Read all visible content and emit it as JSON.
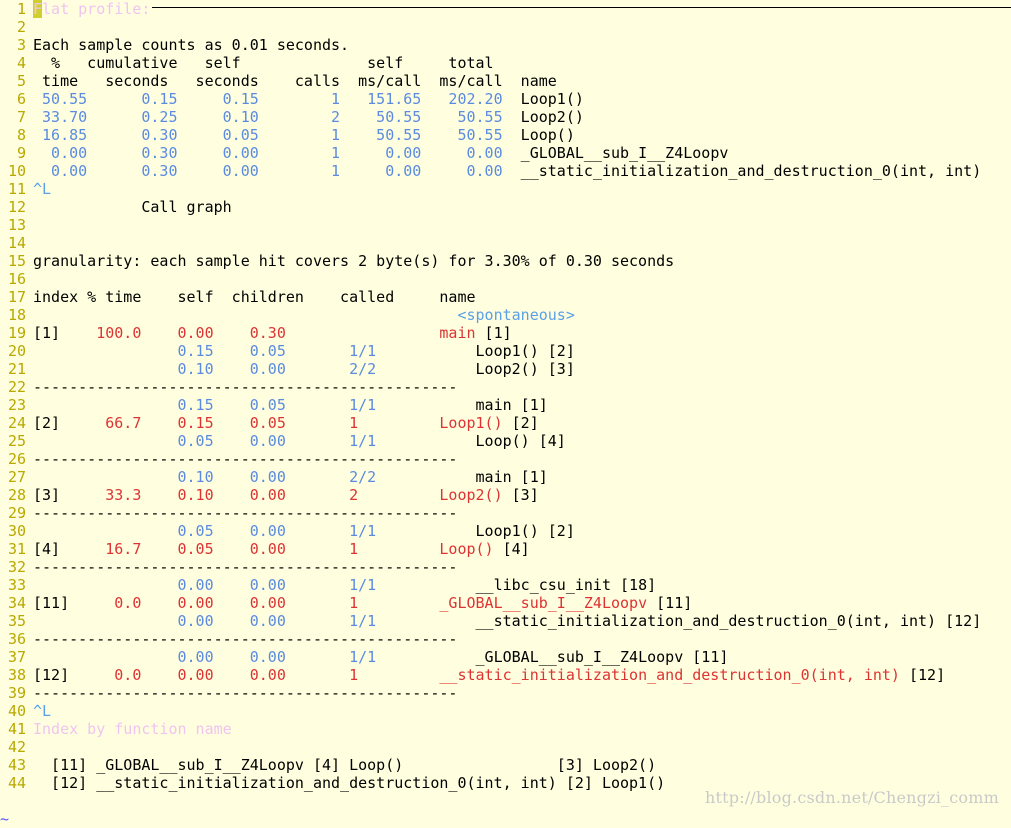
{
  "colors": {
    "default": "#000000",
    "number": "#5a8be0",
    "highlight": "#dd3333",
    "control": "#5aa0e8",
    "comment": "#f0c4f0",
    "linenumber": "#b8a800"
  },
  "lines": [
    {
      "num": "1",
      "segments": [
        {
          "t": "F",
          "c": "comment",
          "cursor": true
        },
        {
          "t": "lat profile:",
          "c": "comment"
        }
      ],
      "rule": true
    },
    {
      "num": "2",
      "segments": []
    },
    {
      "num": "3",
      "segments": [
        {
          "t": "Each sample counts as 0.01 seconds.",
          "c": "default"
        }
      ]
    },
    {
      "num": "4",
      "segments": [
        {
          "t": "  %   cumulative   self              self     total",
          "c": "default"
        }
      ]
    },
    {
      "num": "5",
      "segments": [
        {
          "t": " time   seconds   seconds    calls  ms/call  ms/call  name",
          "c": "default"
        }
      ]
    },
    {
      "num": "6",
      "segments": [
        {
          "t": " 50.55      0.15     0.15        1   151.65   202.20  ",
          "c": "number"
        },
        {
          "t": "Loop1()",
          "c": "default"
        }
      ]
    },
    {
      "num": "7",
      "segments": [
        {
          "t": " 33.70      0.25     0.10        2    50.55    50.55  ",
          "c": "number"
        },
        {
          "t": "Loop2()",
          "c": "default"
        }
      ]
    },
    {
      "num": "8",
      "segments": [
        {
          "t": " 16.85      0.30     0.05        1    50.55    50.55  ",
          "c": "number"
        },
        {
          "t": "Loop()",
          "c": "default"
        }
      ]
    },
    {
      "num": "9",
      "segments": [
        {
          "t": "  0.00      0.30     0.00        1     0.00     0.00  ",
          "c": "number"
        },
        {
          "t": "_GLOBAL__sub_I__Z4Loopv",
          "c": "default"
        }
      ]
    },
    {
      "num": "10",
      "segments": [
        {
          "t": "  0.00      0.30     0.00        1     0.00     0.00  ",
          "c": "number"
        },
        {
          "t": "__static_initialization_and_destruction_0(int, int)",
          "c": "default"
        }
      ]
    },
    {
      "num": "11",
      "segments": [
        {
          "t": "^L",
          "c": "control"
        }
      ]
    },
    {
      "num": "12",
      "segments": [
        {
          "t": "            Call graph",
          "c": "default"
        }
      ]
    },
    {
      "num": "13",
      "segments": []
    },
    {
      "num": "14",
      "segments": []
    },
    {
      "num": "15",
      "segments": [
        {
          "t": "granularity: each sample hit covers 2 byte(s) for 3.30% of 0.30 seconds",
          "c": "default"
        }
      ]
    },
    {
      "num": "16",
      "segments": []
    },
    {
      "num": "17",
      "segments": [
        {
          "t": "index % time    self  children    called     name",
          "c": "default"
        }
      ]
    },
    {
      "num": "18",
      "segments": [
        {
          "t": "                                               <spontaneous>",
          "c": "control"
        }
      ]
    },
    {
      "num": "19",
      "segments": [
        {
          "t": "[1]    ",
          "c": "default"
        },
        {
          "t": "100.0    0.00    0.30                 main",
          "c": "highlight"
        },
        {
          "t": " [1]",
          "c": "default"
        }
      ]
    },
    {
      "num": "20",
      "segments": [
        {
          "t": "                0.15    0.05       1/1           ",
          "c": "number"
        },
        {
          "t": "Loop1() [2]",
          "c": "default"
        }
      ]
    },
    {
      "num": "21",
      "segments": [
        {
          "t": "                0.10    0.00       2/2           ",
          "c": "number"
        },
        {
          "t": "Loop2() [3]",
          "c": "default"
        }
      ]
    },
    {
      "num": "22",
      "segments": [
        {
          "t": "-----------------------------------------------",
          "c": "default"
        }
      ]
    },
    {
      "num": "23",
      "segments": [
        {
          "t": "                0.15    0.05       1/1           ",
          "c": "number"
        },
        {
          "t": "main [1]",
          "c": "default"
        }
      ]
    },
    {
      "num": "24",
      "segments": [
        {
          "t": "[2]     ",
          "c": "default"
        },
        {
          "t": "66.7    0.15    0.05       1         Loop1()",
          "c": "highlight"
        },
        {
          "t": " [2]",
          "c": "default"
        }
      ]
    },
    {
      "num": "25",
      "segments": [
        {
          "t": "                0.05    0.00       1/1           ",
          "c": "number"
        },
        {
          "t": "Loop() [4]",
          "c": "default"
        }
      ]
    },
    {
      "num": "26",
      "segments": [
        {
          "t": "-----------------------------------------------",
          "c": "default"
        }
      ]
    },
    {
      "num": "27",
      "segments": [
        {
          "t": "                0.10    0.00       2/2           ",
          "c": "number"
        },
        {
          "t": "main [1]",
          "c": "default"
        }
      ]
    },
    {
      "num": "28",
      "segments": [
        {
          "t": "[3]     ",
          "c": "default"
        },
        {
          "t": "33.3    0.10    0.00       2         Loop2()",
          "c": "highlight"
        },
        {
          "t": " [3]",
          "c": "default"
        }
      ]
    },
    {
      "num": "29",
      "segments": [
        {
          "t": "-----------------------------------------------",
          "c": "default"
        }
      ]
    },
    {
      "num": "30",
      "segments": [
        {
          "t": "                0.05    0.00       1/1           ",
          "c": "number"
        },
        {
          "t": "Loop1() [2]",
          "c": "default"
        }
      ]
    },
    {
      "num": "31",
      "segments": [
        {
          "t": "[4]     ",
          "c": "default"
        },
        {
          "t": "16.7    0.05    0.00       1         Loop()",
          "c": "highlight"
        },
        {
          "t": " [4]",
          "c": "default"
        }
      ]
    },
    {
      "num": "32",
      "segments": [
        {
          "t": "-----------------------------------------------",
          "c": "default"
        }
      ]
    },
    {
      "num": "33",
      "segments": [
        {
          "t": "                0.00    0.00       1/1           ",
          "c": "number"
        },
        {
          "t": "__libc_csu_init [18]",
          "c": "default"
        }
      ]
    },
    {
      "num": "34",
      "segments": [
        {
          "t": "[11]     ",
          "c": "default"
        },
        {
          "t": "0.0    0.00    0.00       1         _GLOBAL__sub_I__Z4Loopv",
          "c": "highlight"
        },
        {
          "t": " [11]",
          "c": "default"
        }
      ]
    },
    {
      "num": "35",
      "segments": [
        {
          "t": "                0.00    0.00       1/1           ",
          "c": "number"
        },
        {
          "t": "__static_initialization_and_destruction_0(int, int) [12]",
          "c": "default"
        }
      ]
    },
    {
      "num": "36",
      "segments": [
        {
          "t": "-----------------------------------------------",
          "c": "default"
        }
      ]
    },
    {
      "num": "37",
      "segments": [
        {
          "t": "                0.00    0.00       1/1           ",
          "c": "number"
        },
        {
          "t": "_GLOBAL__sub_I__Z4Loopv [11]",
          "c": "default"
        }
      ]
    },
    {
      "num": "38",
      "segments": [
        {
          "t": "[12]     ",
          "c": "default"
        },
        {
          "t": "0.0    0.00    0.00       1         __static_initialization_and_destruction_0(int, int)",
          "c": "highlight"
        },
        {
          "t": " [12]",
          "c": "default"
        }
      ]
    },
    {
      "num": "39",
      "segments": [
        {
          "t": "-----------------------------------------------",
          "c": "default"
        }
      ]
    },
    {
      "num": "40",
      "segments": [
        {
          "t": "^L",
          "c": "control"
        }
      ]
    },
    {
      "num": "41",
      "segments": [
        {
          "t": "Index by function name",
          "c": "comment"
        }
      ]
    },
    {
      "num": "42",
      "segments": []
    },
    {
      "num": "43",
      "segments": [
        {
          "t": "  [11] _GLOBAL__sub_I__Z4Loopv [4] Loop()                 [3] Loop2()",
          "c": "default"
        }
      ]
    },
    {
      "num": "44",
      "segments": [
        {
          "t": "  [12] __static_initialization_and_destruction_0(int, int) [2] Loop1()",
          "c": "default"
        }
      ]
    }
  ],
  "filler": "~",
  "watermark": "http://blog.csdn.net/Chengzi_comm"
}
